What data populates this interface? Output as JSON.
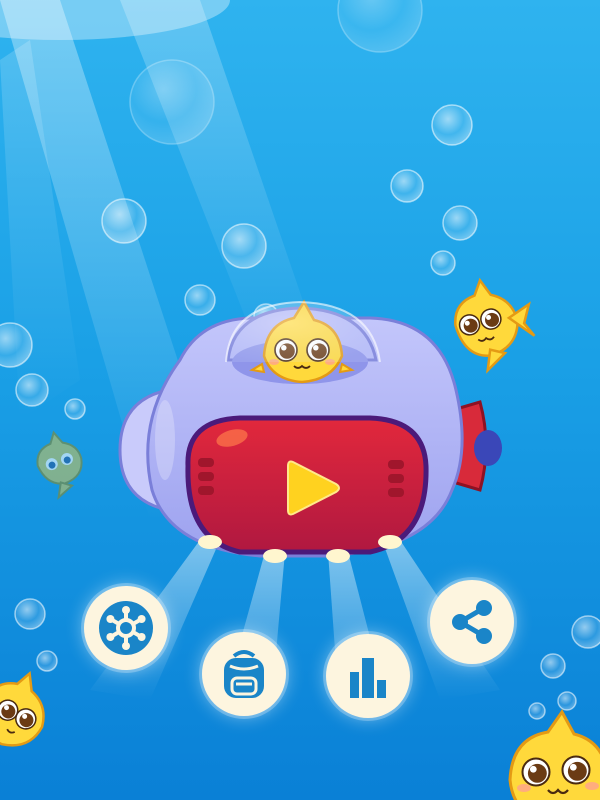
{
  "colors": {
    "water_top": "#2fb3ef",
    "water_bottom": "#0a80d6",
    "submarine_body": "#a9aef5",
    "play_panel": "#d8283f",
    "play_icon": "#ffd21f",
    "fish": "#ffd93b",
    "button_bg": "#fdf5df",
    "icon_blue": "#1a85c8"
  },
  "buttons": {
    "play": {
      "icon": "play-icon"
    },
    "settings": {
      "icon": "gear-icon"
    },
    "bag": {
      "icon": "backpack-icon"
    },
    "rank": {
      "icon": "bar-chart-icon"
    },
    "share": {
      "icon": "share-icon"
    }
  }
}
